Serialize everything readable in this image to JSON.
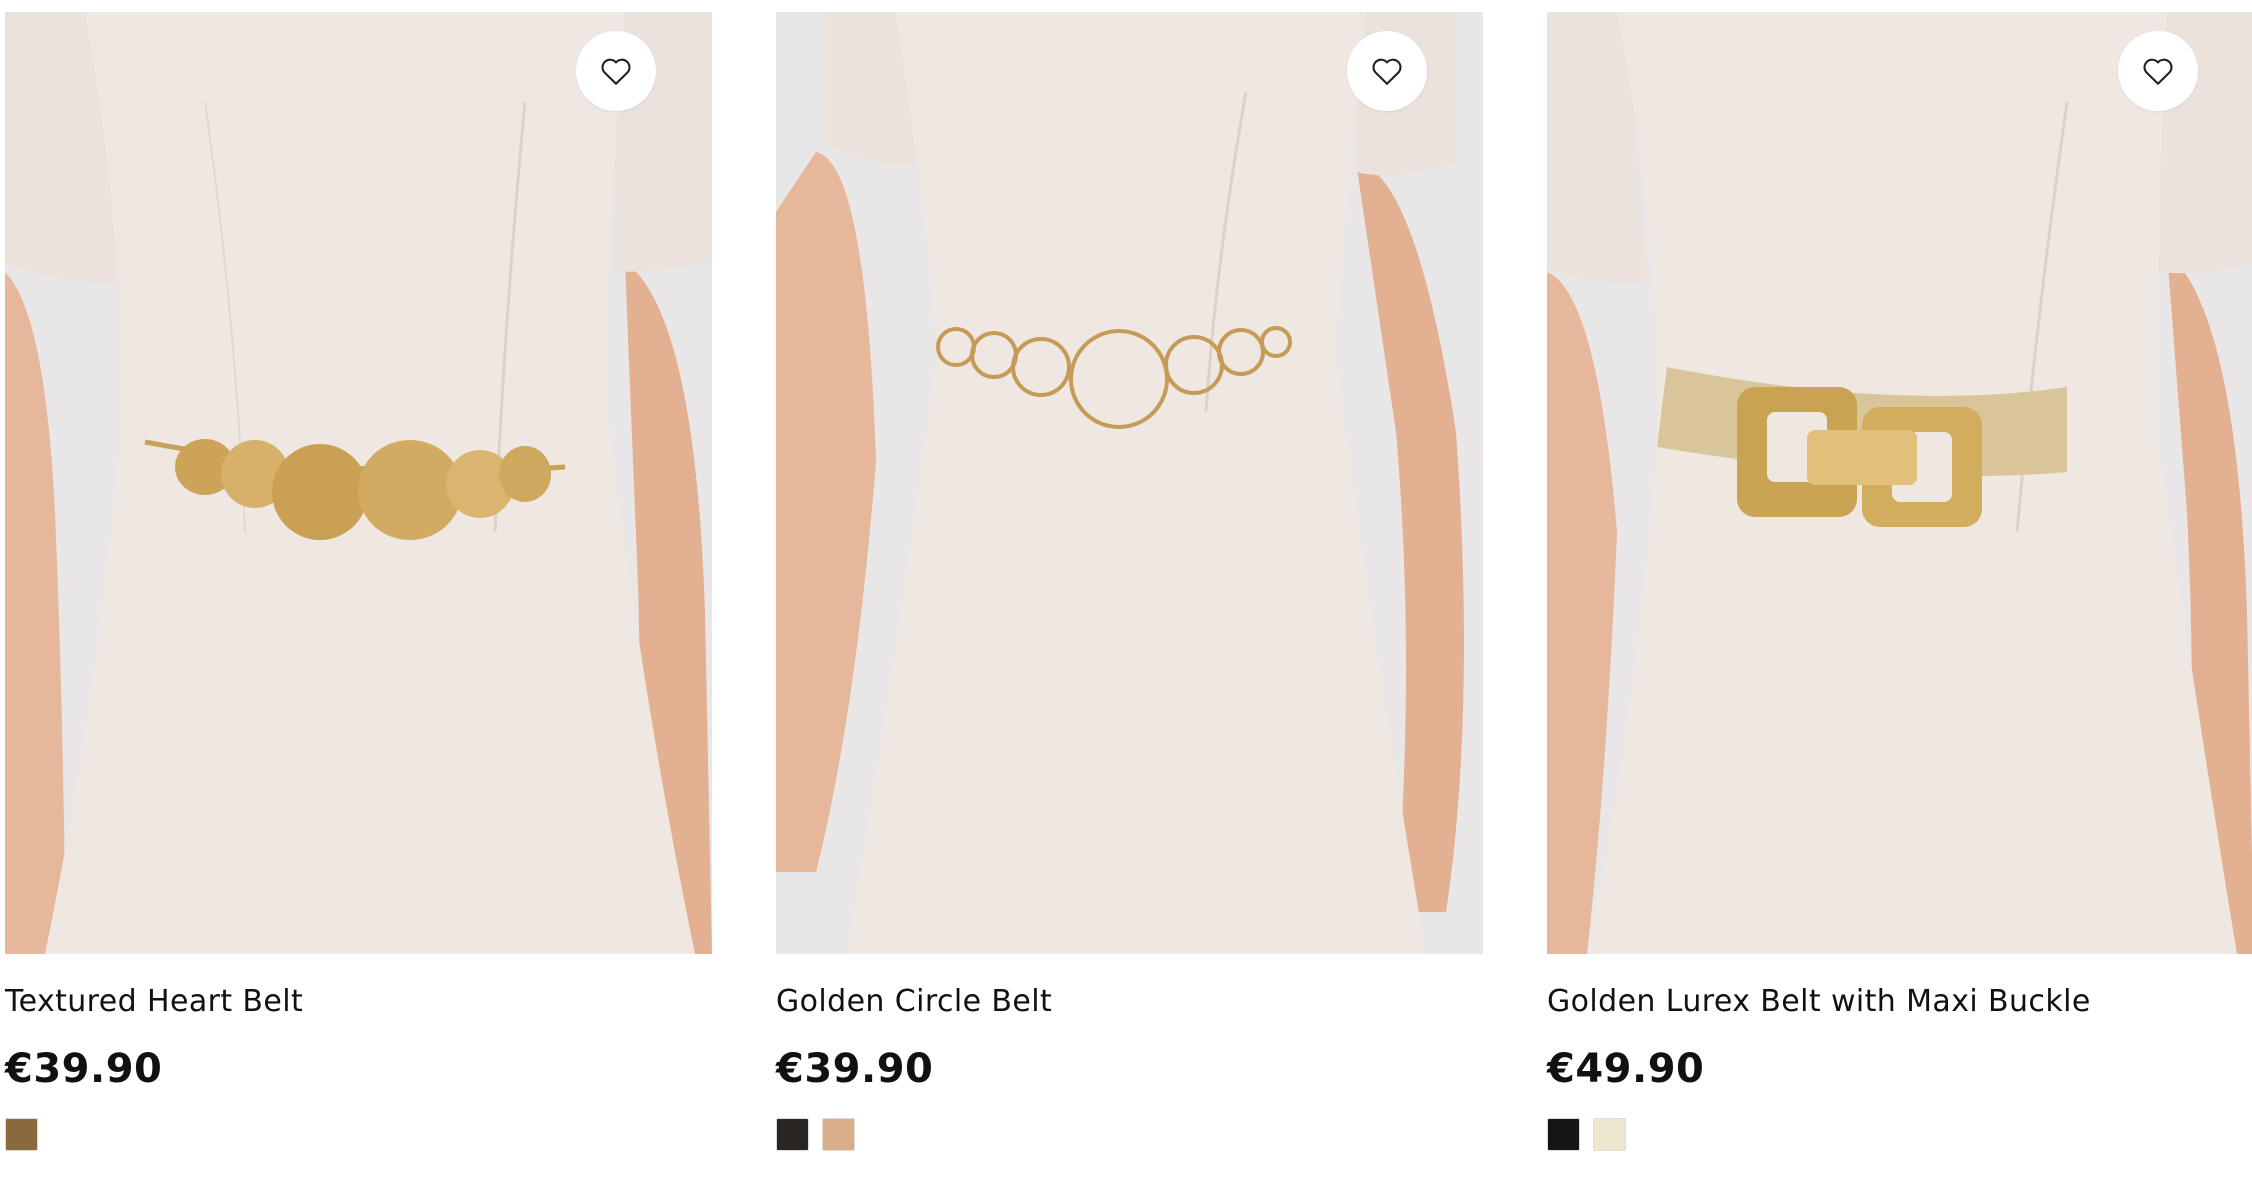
{
  "products": [
    {
      "name": "Textured Heart Belt",
      "price": "€39.90",
      "favorite_icon": "heart-outline-icon",
      "swatches": [
        {
          "label": "gold",
          "color": "#8a6a3c"
        }
      ]
    },
    {
      "name": "Golden Circle Belt",
      "price": "€39.90",
      "favorite_icon": "heart-outline-icon",
      "swatches": [
        {
          "label": "black-pattern",
          "color": "#2a2622"
        },
        {
          "label": "gold",
          "color": "#d7ae87"
        }
      ]
    },
    {
      "name": "Golden Lurex Belt with Maxi Buckle",
      "price": "€49.90",
      "favorite_icon": "heart-outline-icon",
      "swatches": [
        {
          "label": "black",
          "color": "#151515"
        },
        {
          "label": "cream",
          "color": "#efe6cf"
        }
      ]
    }
  ],
  "colors": {
    "dress": "#efe7e2",
    "backdrop": "#e8e6e6",
    "skin": "#e6b79a",
    "gold": "#d9b36a",
    "text": "#111111"
  }
}
